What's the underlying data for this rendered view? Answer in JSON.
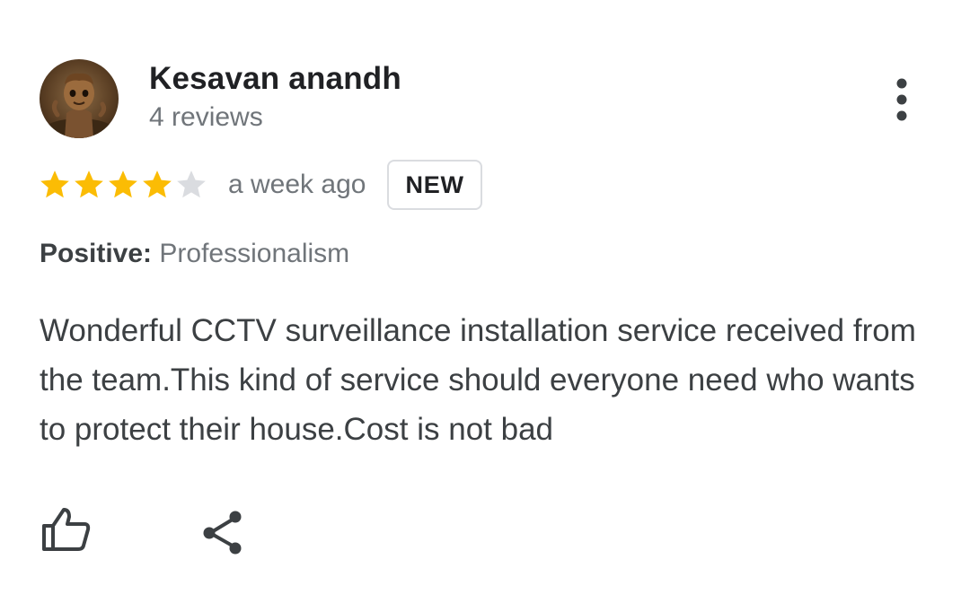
{
  "reviewer": {
    "name": "Kesavan anandh",
    "reviews_count": "4 reviews",
    "avatar_icon": "avatar-photo"
  },
  "rating": {
    "value": 4,
    "max": 5,
    "filled_color": "#fbbc04",
    "empty_color": "#dadce0"
  },
  "time_ago": "a week ago",
  "badge": "NEW",
  "highlight": {
    "label": "Positive:",
    "value": "Professionalism"
  },
  "review_text": "Wonderful CCTV surveillance installation service received from the team.This kind of service should everyone need who wants to protect their house.Cost is not bad",
  "actions": {
    "like_icon": "thumbs-up-icon",
    "share_icon": "share-icon",
    "more_icon": "more-vert-icon"
  },
  "colors": {
    "text_primary": "#202124",
    "text_secondary": "#70757a",
    "body_text": "#3c4043"
  }
}
